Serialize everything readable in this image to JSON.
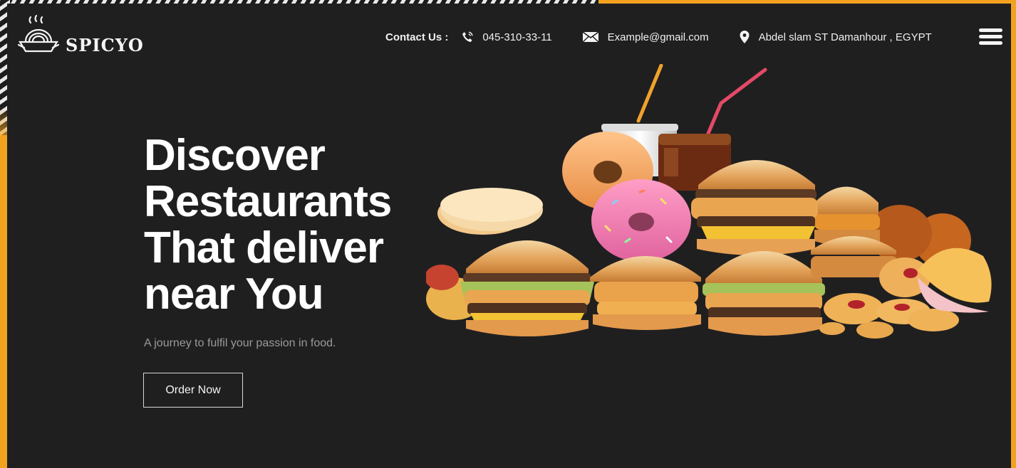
{
  "brand": {
    "name": "SPICYO"
  },
  "header": {
    "contact_label": "Contact Us :",
    "phone": "045-310-33-11",
    "email": "Example@gmail.com",
    "address": "Abdel slam ST Damanhour , EGYPT"
  },
  "hero": {
    "title_lines": [
      "Discover",
      "Restaurants",
      "That deliver",
      "near You"
    ],
    "tagline": "A journey to fulfil your passion in food.",
    "cta_label": "Order Now"
  },
  "icons": {
    "logo": "bowl-steam-icon",
    "phone": "phone-icon",
    "email": "mail-icon",
    "location": "location-pin-icon",
    "menu": "hamburger-menu-icon"
  },
  "colors": {
    "background": "#201f20",
    "accent": "#f2a21e",
    "text": "#ffffff",
    "muted": "#9a9a9a"
  }
}
